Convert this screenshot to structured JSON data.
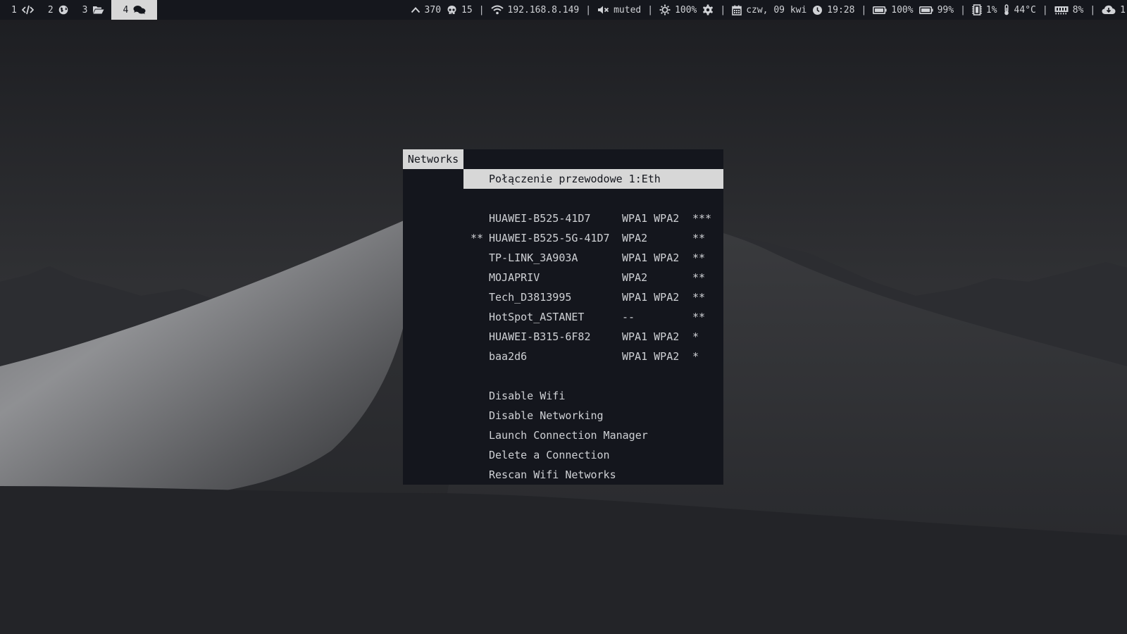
{
  "colors": {
    "bar_bg": "#15171d",
    "bar_fg": "#d0d2d6",
    "menu_bg": "#14161d",
    "menu_fg": "#cfd1d5",
    "highlight": "#d7d7d7"
  },
  "workspaces": [
    {
      "num": "1",
      "icon": "code-icon"
    },
    {
      "num": "2",
      "icon": "globe-icon"
    },
    {
      "num": "3",
      "icon": "folder-open-icon"
    },
    {
      "num": "4",
      "icon": "chat-icon",
      "active": true
    }
  ],
  "status": {
    "updates": {
      "icon": "chevron-up-icon",
      "value": "370"
    },
    "skull": {
      "icon": "skull-icon",
      "value": "15"
    },
    "sep1": "|",
    "network": {
      "icon": "wifi-icon",
      "value": "192.168.8.149"
    },
    "sep2": "|",
    "volume": {
      "icon": "volume-muted-icon",
      "value": "muted"
    },
    "sep3": "|",
    "brightness": {
      "icon": "brightness-icon",
      "value": "100%"
    },
    "settings": {
      "icon": "gear-icon"
    },
    "sep4": "|",
    "date": {
      "icon": "calendar-icon",
      "value": "czw, 09 kwi"
    },
    "time": {
      "icon": "clock-icon",
      "value": "19:28"
    },
    "sep5": "|",
    "battery1": {
      "icon": "battery-full-icon",
      "value": "100%"
    },
    "battery2": {
      "icon": "battery-full-icon",
      "value": "99%"
    },
    "sep6": "|",
    "cpu": {
      "icon": "cpu-icon",
      "value": "1%"
    },
    "temperature": {
      "icon": "thermometer-icon",
      "value": "44°C"
    },
    "sep7": "|",
    "memory": {
      "icon": "memory-icon",
      "value": "8%"
    },
    "sep8": "|",
    "cloud": {
      "icon": "cloud-download-icon",
      "value": "1"
    }
  },
  "menu": {
    "prompt": "Networks",
    "query": "",
    "selected": {
      "text": "Połączenie przewodowe 1:Eth"
    },
    "networks": [
      {
        "mark": "",
        "ssid": "HUAWEI-B525-41D7",
        "security": "WPA1 WPA2",
        "signal": "***"
      },
      {
        "mark": "**",
        "ssid": "HUAWEI-B525-5G-41D7",
        "security": "WPA2",
        "signal": "**"
      },
      {
        "mark": "",
        "ssid": "TP-LINK_3A903A",
        "security": "WPA1 WPA2",
        "signal": "**"
      },
      {
        "mark": "",
        "ssid": "MOJAPRIV",
        "security": "WPA2",
        "signal": "**"
      },
      {
        "mark": "",
        "ssid": "Tech_D3813995",
        "security": "WPA1 WPA2",
        "signal": "**"
      },
      {
        "mark": "",
        "ssid": "HotSpot_ASTANET",
        "security": "--",
        "signal": "**"
      },
      {
        "mark": "",
        "ssid": "HUAWEI-B315-6F82",
        "security": "WPA1 WPA2",
        "signal": "*"
      },
      {
        "mark": "",
        "ssid": "baa2d6",
        "security": "WPA1 WPA2",
        "signal": "*"
      }
    ],
    "actions": [
      "Disable Wifi",
      "Disable Networking",
      "Launch Connection Manager",
      "Delete a Connection",
      "Rescan Wifi Networks"
    ]
  }
}
